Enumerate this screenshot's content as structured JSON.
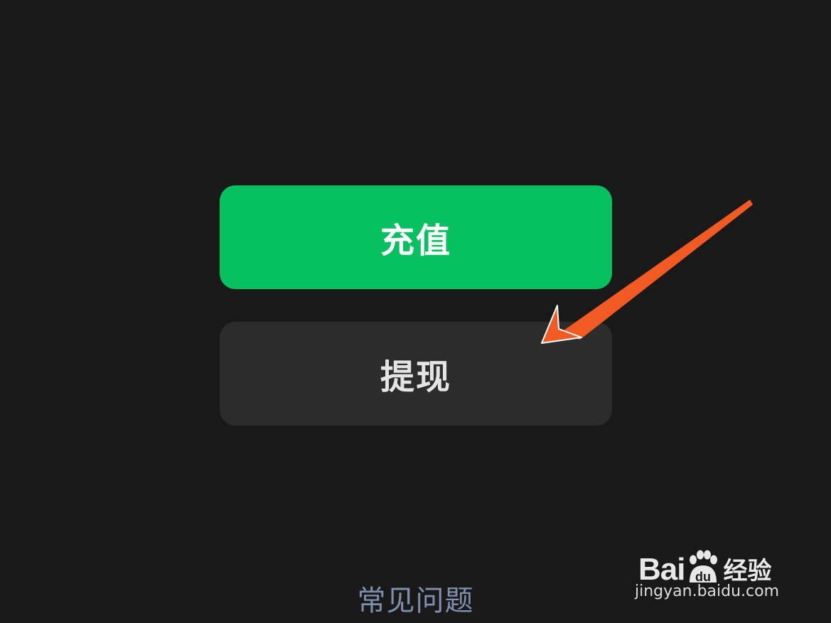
{
  "actions": {
    "recharge_label": "充值",
    "withdraw_label": "提现"
  },
  "footer": {
    "faq_label": "常见问题"
  },
  "watermark": {
    "brand_prefix": "Bai",
    "brand_paw": "du",
    "brand_suffix": "经验",
    "url": "jingyan.baidu.com"
  },
  "colors": {
    "background": "#191919",
    "primary_button": "#07C160",
    "secondary_button": "#2c2c2c",
    "link": "#7e90ad",
    "annotation_arrow": "#f25a24"
  }
}
